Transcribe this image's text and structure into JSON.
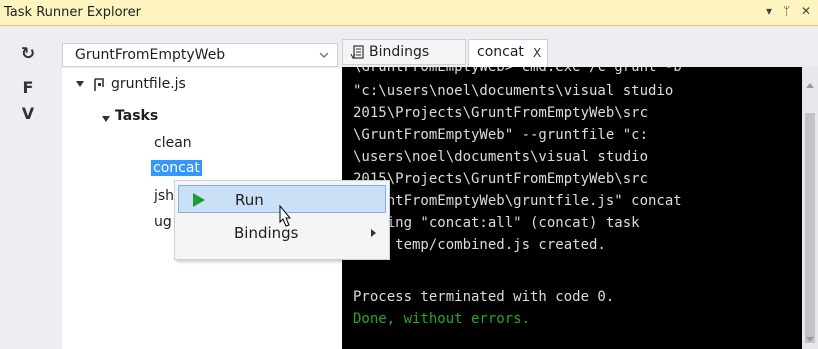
{
  "window": {
    "title": "Task Runner Explorer",
    "controls": {
      "dropdown": "▾",
      "pin": "ᛘ",
      "close": "✕"
    }
  },
  "toolbar": {
    "refresh_glyph": "↻",
    "f_label": "F",
    "v_label": "V"
  },
  "project_selector": {
    "value": "GruntFromEmptyWeb"
  },
  "tree": {
    "file": "gruntfile.js",
    "group": "Tasks",
    "tasks": [
      "clean",
      "concat",
      "jsh",
      "ug"
    ]
  },
  "tabs": {
    "bindings": "Bindings",
    "concat": "concat",
    "concat_close": "X"
  },
  "console": {
    "lines": [
      "\\GruntFromEmptyWeb> cmd.exe /c grunt -b",
      "\"c:\\users\\noel\\documents\\visual studio",
      "2015\\Projects\\GruntFromEmptyWeb\\src",
      "\\GruntFromEmptyWeb\" --gruntfile \"c:",
      "\\users\\noel\\documents\\visual studio",
      "2015\\Projects\\GruntFromEmptyWeb\\src",
      "\\GruntFromEmptyWeb\\gruntfile.js\" concat",
      "Running \"concat:all\" (concat) task",
      "File temp/combined.js created.",
      "",
      "Process terminated with code 0.",
      "Done, without errors."
    ]
  },
  "context_menu": {
    "run": "Run",
    "bindings": "Bindings"
  },
  "colors": {
    "title_bg": "#fdf4bf",
    "selection": "#3399ff",
    "console_bg": "#000000",
    "success": "#22aa22",
    "play_icon": "#1e9c3a"
  }
}
